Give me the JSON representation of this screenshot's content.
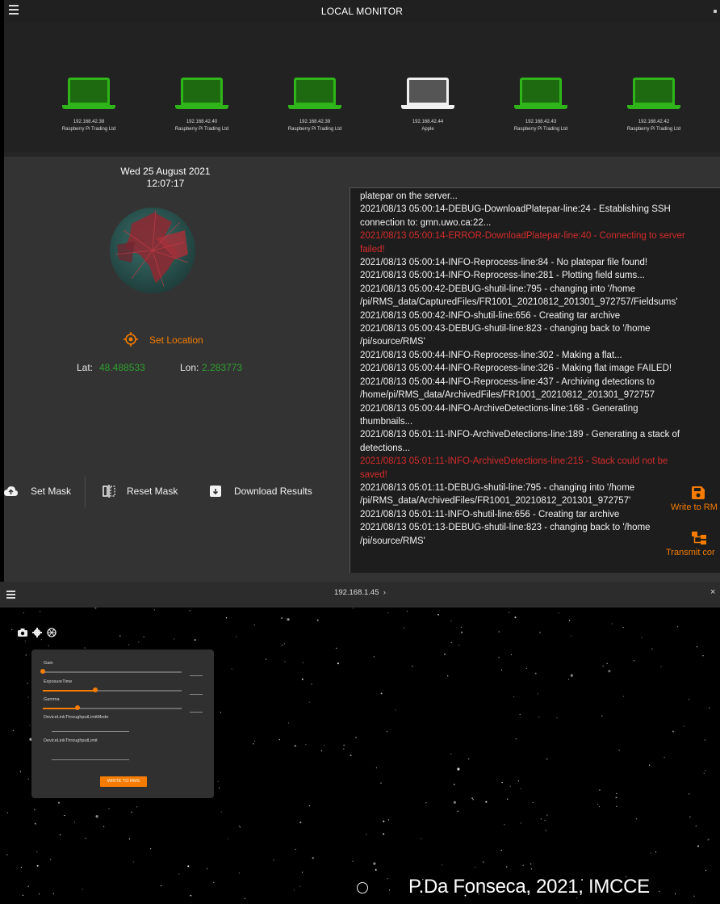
{
  "colors": {
    "accent": "#f57c00",
    "online": "#2fb51a",
    "error": "#d42b2b",
    "coordinate": "#2ea02e"
  },
  "top": {
    "title": "LOCAL MONITOR",
    "devices": [
      {
        "ip": "192.168.42.38",
        "vendor": "Raspberry Pi Trading Ltd",
        "icon": "laptop-icon",
        "state": "online"
      },
      {
        "ip": "192.168.42.40",
        "vendor": "Raspberry Pi Trading Ltd",
        "icon": "laptop-icon",
        "state": "online"
      },
      {
        "ip": "192.168.42.39",
        "vendor": "Raspberry Pi Trading Ltd",
        "icon": "laptop-icon",
        "state": "online"
      },
      {
        "ip": "192.168.42.44",
        "vendor": "Apple",
        "icon": "laptop-icon",
        "state": "selected"
      },
      {
        "ip": "192.168.42.43",
        "vendor": "Raspberry Pi Trading Ltd",
        "icon": "laptop-icon",
        "state": "online"
      },
      {
        "ip": "192.168.42.42",
        "vendor": "Raspberry Pi Trading Ltd",
        "icon": "laptop-icon",
        "state": "online"
      }
    ],
    "date": "Wed 25 August 2021",
    "time": "12:07:17",
    "set_location": "Set Location",
    "lat_label": "Lat:",
    "lat_value": "48.488533",
    "lon_label": "Lon:",
    "lon_value": "2.283773",
    "buttons": {
      "set_mask": "Set Mask",
      "reset_mask": "Reset Mask",
      "download": "Download Results"
    },
    "log_lines": [
      {
        "text": "platepar on the server...",
        "level": "info"
      },
      {
        "text": "2021/08/13 05:00:14-DEBUG-DownloadPlatepar-line:24 - Establishing SSH",
        "level": "info"
      },
      {
        "text": "connection to: gmn.uwo.ca:22...",
        "level": "info"
      },
      {
        "text": "2021/08/13 05:00:14-ERROR-DownloadPlatepar-line:40 - Connecting to server",
        "level": "error"
      },
      {
        "text": "failed!",
        "level": "error"
      },
      {
        "text": "2021/08/13 05:00:14-INFO-Reprocess-line:84 - No platepar file found!",
        "level": "info"
      },
      {
        "text": "2021/08/13 05:00:14-INFO-Reprocess-line:281 - Plotting field sums...",
        "level": "info"
      },
      {
        "text": "2021/08/13 05:00:42-DEBUG-shutil-line:795 - changing into '/home",
        "level": "info"
      },
      {
        "text": "/pi/RMS_data/CapturedFiles/FR1001_20210812_201301_972757/Fieldsums'",
        "level": "info"
      },
      {
        "text": "2021/08/13 05:00:42-INFO-shutil-line:656 - Creating tar archive",
        "level": "info"
      },
      {
        "text": "2021/08/13 05:00:43-DEBUG-shutil-line:823 - changing back to '/home",
        "level": "info"
      },
      {
        "text": "/pi/source/RMS'",
        "level": "info"
      },
      {
        "text": "2021/08/13 05:00:44-INFO-Reprocess-line:302 - Making a flat...",
        "level": "info"
      },
      {
        "text": "2021/08/13 05:00:44-INFO-Reprocess-line:326 - Making flat image FAILED!",
        "level": "info"
      },
      {
        "text": "2021/08/13 05:00:44-INFO-Reprocess-line:437 - Archiving detections to",
        "level": "info"
      },
      {
        "text": "/home/pi/RMS_data/ArchivedFiles/FR1001_20210812_201301_972757",
        "level": "info"
      },
      {
        "text": "2021/08/13 05:00:44-INFO-ArchiveDetections-line:168 - Generating",
        "level": "info"
      },
      {
        "text": "thumbnails...",
        "level": "info"
      },
      {
        "text": "2021/08/13 05:01:11-INFO-ArchiveDetections-line:189 - Generating a stack of",
        "level": "info"
      },
      {
        "text": "detections...",
        "level": "info"
      },
      {
        "text": "2021/08/13 05:01:11-INFO-ArchiveDetections-line:215 - Stack could not be",
        "level": "error"
      },
      {
        "text": "saved!",
        "level": "error"
      },
      {
        "text": "2021/08/13 05:01:11-DEBUG-shutil-line:795 - changing into '/home",
        "level": "info"
      },
      {
        "text": "/pi/RMS_data/ArchivedFiles/FR1001_20210812_201301_972757'",
        "level": "info"
      },
      {
        "text": "2021/08/13 05:01:11-INFO-shutil-line:656 - Creating tar archive",
        "level": "info"
      },
      {
        "text": "2021/08/13 05:01:13-DEBUG-shutil-line:823 - changing back to '/home",
        "level": "info"
      },
      {
        "text": "/pi/source/RMS'",
        "level": "info"
      }
    ],
    "write_to_rm": "Write to RM",
    "transmit": "Transmit cor"
  },
  "viewer": {
    "ip": "192.168.1.45",
    "chevron": "›",
    "close": "×",
    "controls": {
      "gain_label": "Gain",
      "gain_value": 0,
      "exposure_label": "ExposureTime",
      "exposure_value": 0.38,
      "gamma_label": "Gamma",
      "gamma_value": 0.25,
      "link_mode_label": "DeviceLinkThroughputLimitMode",
      "link_limit_label": "DeviceLinkThroughputLimit",
      "write_button": "WRITE TO RMS"
    },
    "credit": "P.Da Fonseca, 2021, IMCCE"
  }
}
